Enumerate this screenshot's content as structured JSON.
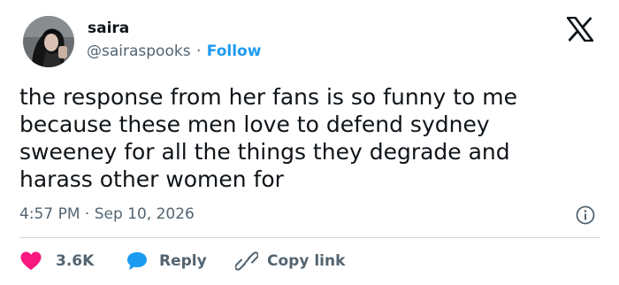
{
  "author": {
    "name": "saira",
    "handle": "@sairaspooks",
    "separator": "·",
    "follow_label": "Follow"
  },
  "tweet": {
    "lines": [
      "the response from her fans is so funny to me",
      "because these men love to defend sydney",
      "sweeney for all the things they degrade and",
      "harass other women for"
    ],
    "time": "4:57 PM",
    "date_separator": "·",
    "date": "Sep 10, 2026"
  },
  "actions": {
    "likes": "3.6K",
    "reply_label": "Reply",
    "copy_label": "Copy link"
  },
  "icons": {
    "brand": "x-logo-icon",
    "info": "info-icon",
    "like": "heart-icon",
    "reply": "speech-bubble-icon",
    "copy": "link-icon"
  },
  "colors": {
    "text": "#0f1419",
    "muted": "#536471",
    "accent": "#1d9bf0",
    "like": "#f91880",
    "divider": "#cfd9de"
  }
}
